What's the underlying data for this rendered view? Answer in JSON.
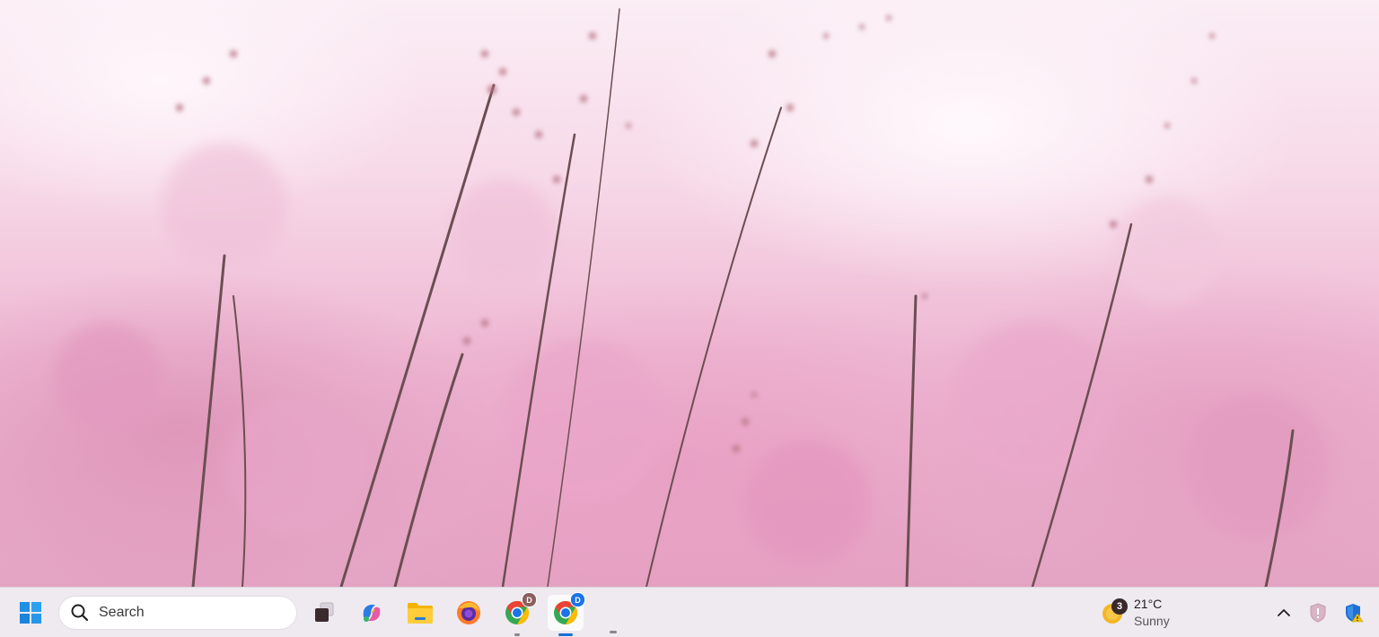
{
  "desktop": {
    "wallpaper": "pink-grass-field"
  },
  "taskbar": {
    "start_icon": "windows-start-icon",
    "search": {
      "label": "Search",
      "icon": "search-icon"
    },
    "apps": [
      {
        "name": "task-view",
        "icon": "task-view-icon",
        "running": false
      },
      {
        "name": "copilot",
        "icon": "copilot-icon",
        "running": false
      },
      {
        "name": "file-explorer",
        "icon": "folder-icon",
        "running": false
      },
      {
        "name": "firefox",
        "icon": "firefox-icon",
        "running": false
      },
      {
        "name": "chrome-profile-d-1",
        "icon": "chrome-icon",
        "profile_letter": "D",
        "profile_color": "#8b5e5e",
        "running": true
      },
      {
        "name": "chrome-profile-d-2",
        "icon": "chrome-icon",
        "profile_letter": "D",
        "profile_color": "#1a73e8",
        "running": true,
        "active": true
      }
    ],
    "weather": {
      "badge": "3",
      "temperature": "21°C",
      "condition": "Sunny"
    },
    "tray": {
      "overflow_icon": "chevron-up-icon",
      "security_icon": "shield-alert-icon",
      "defender_icon": "defender-warning-icon"
    },
    "colors": {
      "taskbar_bg": "#eeeaf0",
      "accent": "#1a6fd6"
    }
  }
}
